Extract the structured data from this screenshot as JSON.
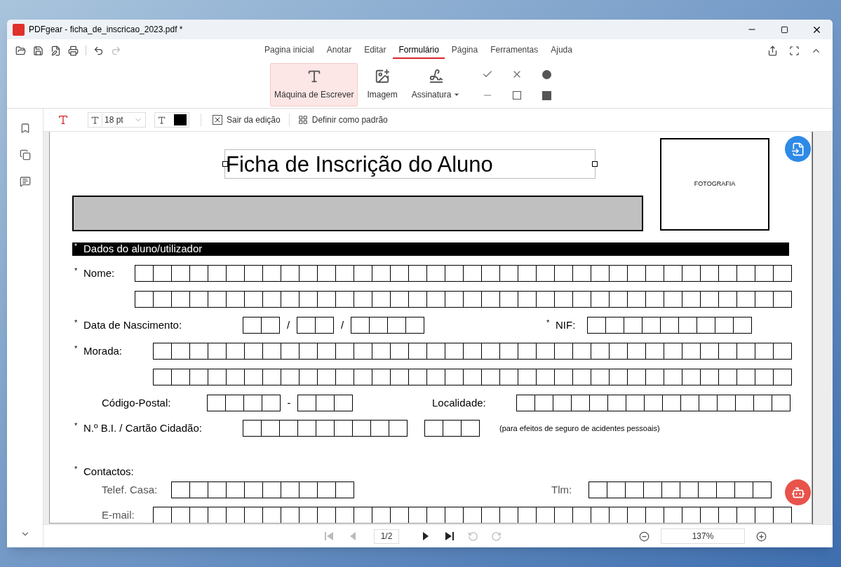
{
  "window": {
    "title": "PDFgear - ficha_de_inscricao_2023.pdf *"
  },
  "menu_tabs": [
    {
      "label": "Pagina inicial",
      "selected": false
    },
    {
      "label": "Anotar",
      "selected": false
    },
    {
      "label": "Editar",
      "selected": false
    },
    {
      "label": "Formulário",
      "selected": true
    },
    {
      "label": "Página",
      "selected": false
    },
    {
      "label": "Ferramentas",
      "selected": false
    },
    {
      "label": "Ajuda",
      "selected": false
    }
  ],
  "ribbon": {
    "tools": [
      {
        "kind": "typewriter",
        "label": "Máquina de Escrever",
        "selected": true
      },
      {
        "kind": "image",
        "label": "Imagem",
        "selected": false
      },
      {
        "kind": "signature",
        "label": "Assinatura",
        "selected": false
      }
    ]
  },
  "text_toolbar": {
    "font_size": "18 pt",
    "exit_button": "Sair da edição",
    "default_button": "Definir como padrão"
  },
  "document": {
    "title": "Ficha de Inscrição do Aluno",
    "photo_label": "FOTOGRAFIA",
    "section": {
      "marker": "*",
      "title": "Dados do aluno/utilizador"
    },
    "fields": [
      {
        "marker": "*",
        "label": "Nome:"
      },
      {
        "marker": "*",
        "label": "Data de Nascimento:",
        "separators": [
          "/",
          "/"
        ]
      },
      {
        "marker": "*",
        "label": "NIF:"
      },
      {
        "marker": "*",
        "label": "Morada:"
      },
      {
        "label": "Código-Postal:",
        "separators": [
          "-"
        ]
      },
      {
        "label": "Localidade:"
      },
      {
        "marker": "*",
        "label": "N.º B.I. / Cartão Cidadão:",
        "note": "(para efeitos de seguro de acidentes pessoais)"
      },
      {
        "marker": "*",
        "label": "Contactos:"
      },
      {
        "label": "Telef. Casa:"
      },
      {
        "label": "Tlm:"
      },
      {
        "label": "E-mail:"
      }
    ]
  },
  "pager": {
    "page": "1/2",
    "zoom": "137%"
  }
}
